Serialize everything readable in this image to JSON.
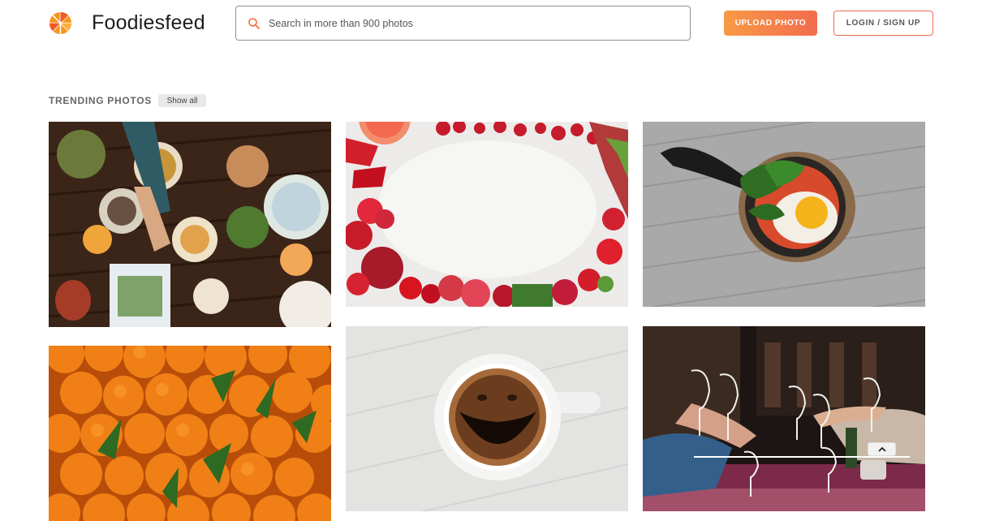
{
  "header": {
    "brand": "Foodiesfeed",
    "search_placeholder": "Search in more than 900 photos",
    "upload_label": "UPLOAD PHOTO",
    "login_label": "LOGIN / SIGN UP"
  },
  "trending": {
    "title": "TRENDING PHOTOS",
    "show_all_label": "Show all"
  },
  "photos": [
    {
      "name": "table-feast-photo"
    },
    {
      "name": "red-fruits-frame-photo"
    },
    {
      "name": "skillet-egg-photo"
    },
    {
      "name": "tangerines-photo"
    },
    {
      "name": "coffee-cup-photo"
    },
    {
      "name": "wine-toast-photo"
    }
  ],
  "colors": {
    "accent_orange": "#f79a46",
    "accent_red": "#f26c4e"
  }
}
